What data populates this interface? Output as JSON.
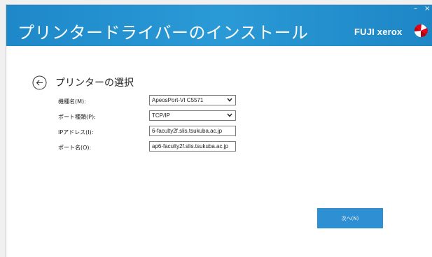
{
  "window": {
    "minimize_glyph": "–",
    "close_glyph": "×"
  },
  "header": {
    "title": "プリンタードライバーのインストール",
    "brand": "FUJI xerox",
    "brand_logo_icon": "fuji-xerox-logo-icon"
  },
  "page": {
    "back_icon": "back-arrow-icon",
    "section_title": "プリンターの選択"
  },
  "form": {
    "model_label": "機種名(M):",
    "model_value": "ApeosPort-VI C5571",
    "port_type_label": "ポート種類(P):",
    "port_type_value": "TCP/IP",
    "ip_label": "IPアドレス(I):",
    "ip_value": "6-faculty2f.slis.tsukuba.ac.jp",
    "port_name_label": "ポート名(O):",
    "port_name_value": "ap6-faculty2f.slis.tsukuba.ac.jp"
  },
  "actions": {
    "next_label": "次へ(N)"
  },
  "colors": {
    "banner": "#2a9ad6",
    "button": "#2e8fd3"
  }
}
